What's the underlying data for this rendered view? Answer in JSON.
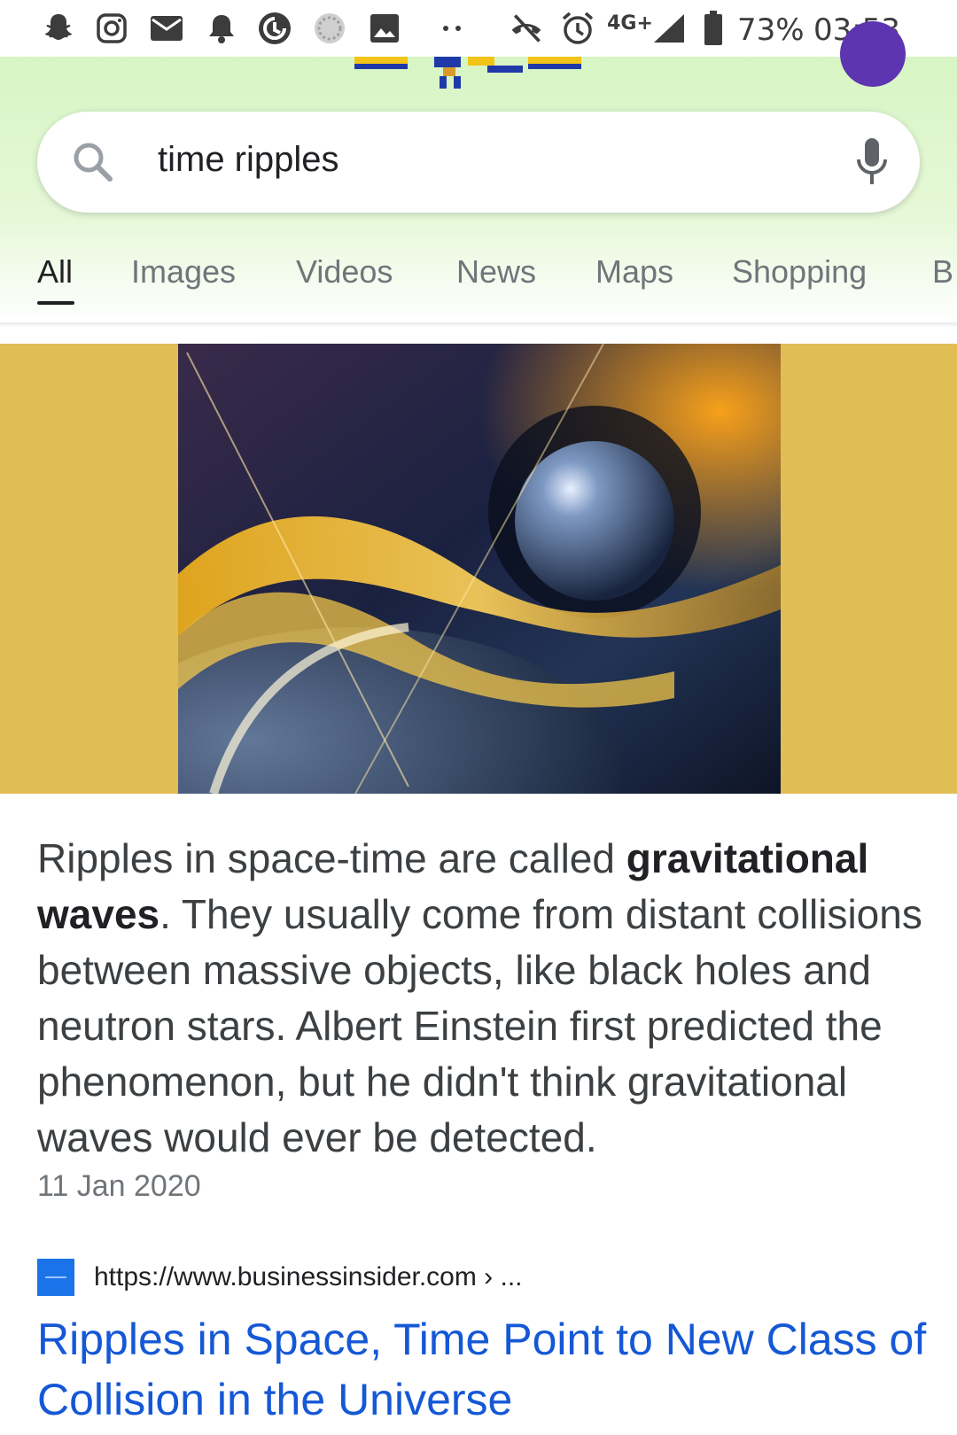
{
  "status_bar": {
    "icons": [
      "snapchat-icon",
      "instagram-icon",
      "mail-icon",
      "notification-bell-icon",
      "sync-icon",
      "loading-icon",
      "image-icon",
      "more-dots-icon",
      "no-call-icon",
      "alarm-icon",
      "network-4g-icon",
      "signal-icon",
      "battery-icon"
    ],
    "network": "4G+",
    "battery": "73%",
    "time": "03:53"
  },
  "search": {
    "query": "time ripples"
  },
  "tabs": [
    {
      "label": "All",
      "active": true
    },
    {
      "label": "Images"
    },
    {
      "label": "Videos"
    },
    {
      "label": "News"
    },
    {
      "label": "Maps"
    },
    {
      "label": "Shopping"
    },
    {
      "label": "B"
    }
  ],
  "featured_snippet": {
    "text_before_bold": "Ripples in space-time are called ",
    "bold": "gravitational waves",
    "text_after_bold": ". They usually come from distant collisions between massive objects, like black holes and neutron stars. Albert Einstein first predicted the phenomenon, but he didn't think gravitational waves would ever be detected.",
    "date": "11 Jan 2020"
  },
  "result": {
    "url": "https://www.businessinsider.com › ...",
    "title": "Ripples in Space, Time Point to New Class of Collision in the Universe"
  },
  "colors": {
    "header_green": "#d7f5c4",
    "image_band": "#e0bd55",
    "link_blue": "#1558d6",
    "favicon_blue": "#1a73e8"
  }
}
